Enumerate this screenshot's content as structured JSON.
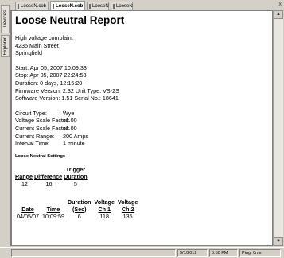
{
  "side_tabs": [
    {
      "label": "Devices"
    },
    {
      "label": "Explorer"
    }
  ],
  "tabs": [
    {
      "label": "LooseN.cob"
    },
    {
      "label": "LooseN.cob"
    },
    {
      "label": "LooseN"
    },
    {
      "label": "LooseN"
    }
  ],
  "tab_close": "x",
  "report": {
    "title": "Loose Neutral Report",
    "address": [
      "High voltage complaint",
      "4235 Main Street",
      "Springfield"
    ],
    "timing": [
      "Start: Apr 05, 2007 10:09:33",
      "Stop: Apr 05, 2007 22:24:53",
      "Duration: 0 days, 12:15:20",
      "Firmware Version: 2.32 Unit Type: VS-2S",
      "Software Version: 1.51 Serial No.: 18641"
    ],
    "settings": [
      {
        "key": "Circuit Type:",
        "value": "Wye"
      },
      {
        "key": "Voltage Scale Factor:",
        "value": "x1.00"
      },
      {
        "key": "Current Scale Factor:",
        "value": "x1.00"
      },
      {
        "key": "Current Range:",
        "value": "200 Amps"
      },
      {
        "key": "Interval Time:",
        "value": "1 minute"
      }
    ],
    "section_label": "Loose Neutral Settings",
    "settings_table": {
      "trigger_header": "Trigger",
      "columns": [
        "Range",
        "Difference",
        "Duration"
      ],
      "row": [
        "12",
        "16",
        "5"
      ]
    },
    "events_table": {
      "header_top": [
        "Duration",
        "Voltage",
        "Voltage"
      ],
      "columns": [
        "Date",
        "Time",
        "(Sec)",
        "Ch 1",
        "Ch 2"
      ],
      "rows": [
        [
          "04/05/07",
          "10:09:59",
          "6",
          "118",
          "135"
        ]
      ]
    }
  },
  "statusbar": {
    "date": "5/1/2012",
    "time": "5:50 PM",
    "ping": "Ping: 0ms"
  },
  "scroll_up": "▲",
  "scroll_down": "▼"
}
